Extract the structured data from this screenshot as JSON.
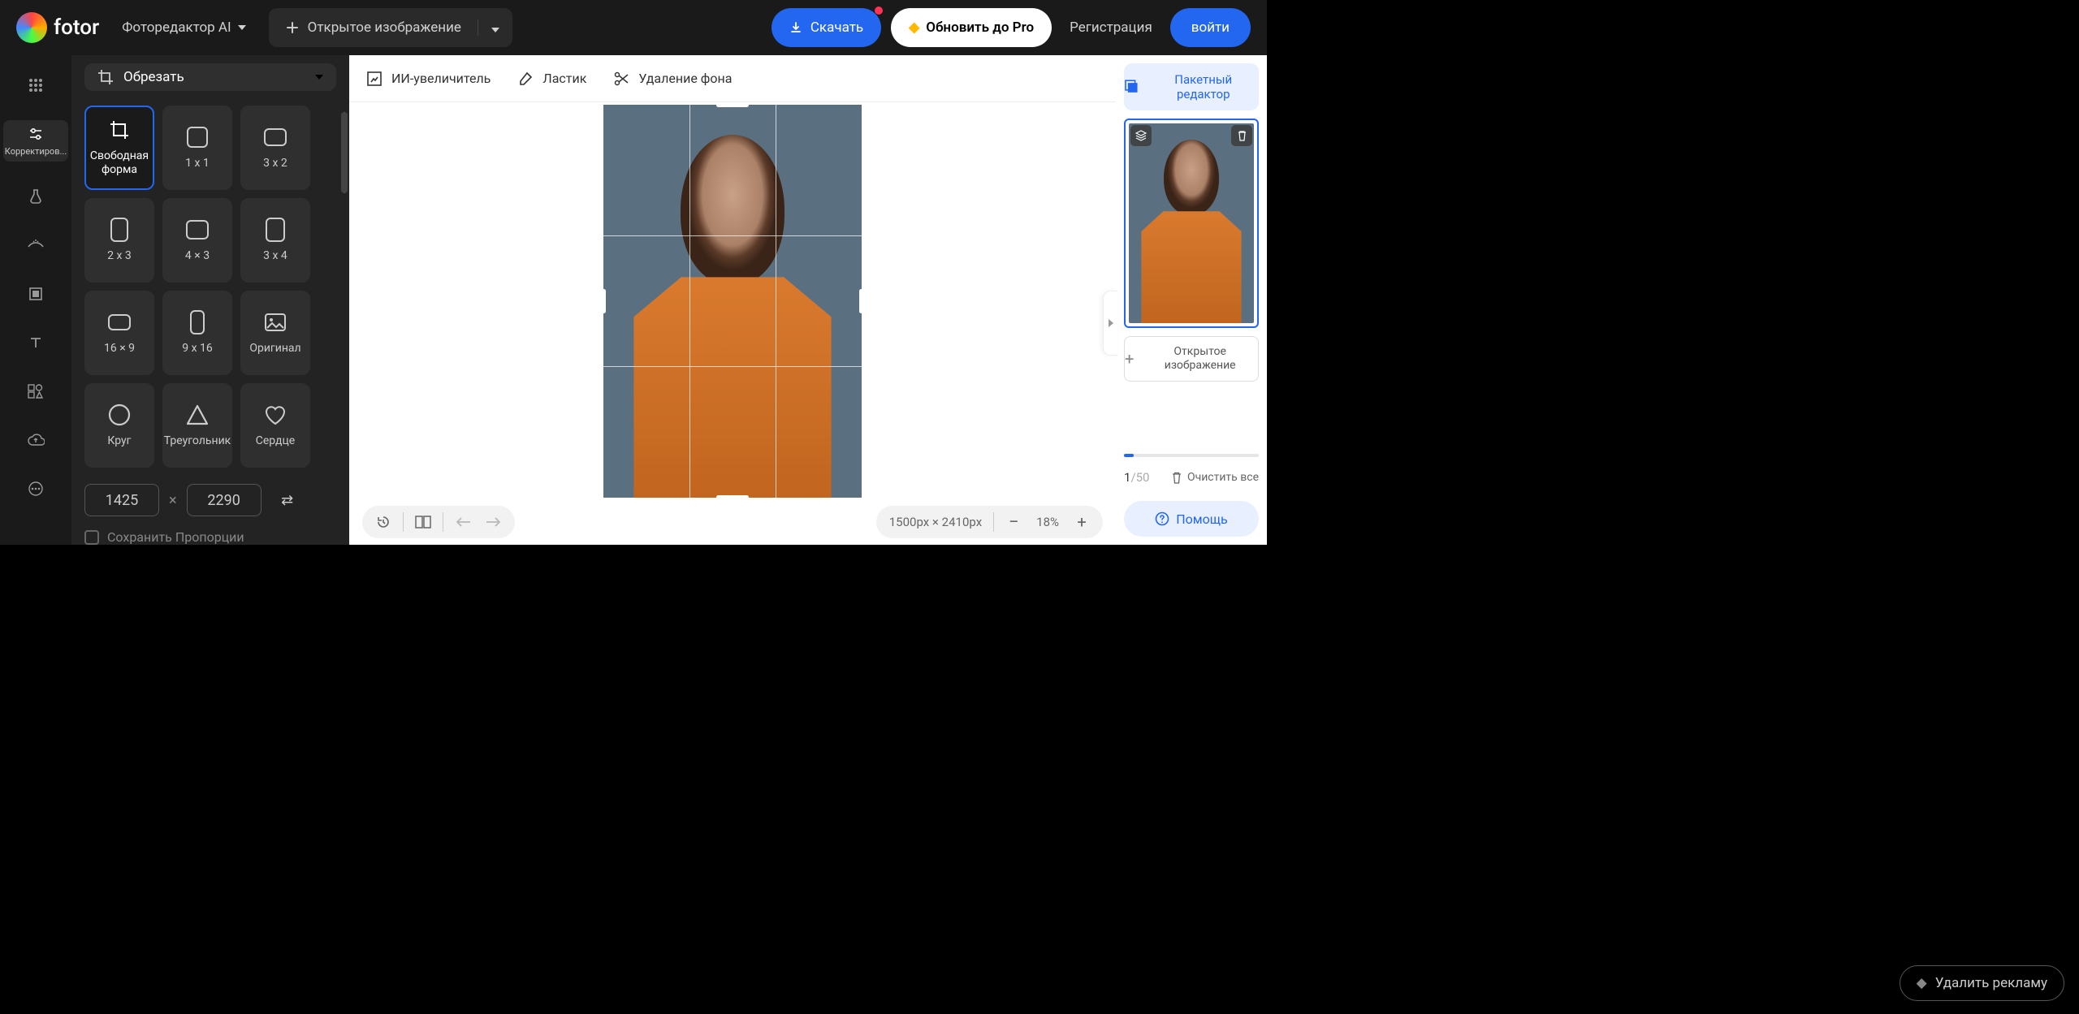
{
  "header": {
    "logo_text": "fotor",
    "mode": "Фоторедактор AI",
    "open_image": "Открытое изображение",
    "download": "Скачать",
    "upgrade": "Обновить до Pro",
    "register": "Регистрация",
    "login": "войти"
  },
  "toolbar": {
    "adjust": "Корректиров..."
  },
  "crop_panel": {
    "title": "Обрезать",
    "options": [
      "Свободная форма",
      "1 x 1",
      "3 x 2",
      "2 x 3",
      "4 × 3",
      "3 x 4",
      "16 × 9",
      "9 x 16",
      "Оригинал",
      "Круг",
      "Треугольник",
      "Сердце"
    ],
    "width": "1425",
    "height": "2290",
    "keep_proportions": "Сохранить Пропорции"
  },
  "canvas_toolbar": {
    "upscaler": "ИИ-увеличитель",
    "eraser": "Ластик",
    "bg_remove": "Удаление фона"
  },
  "canvas_bottom": {
    "dims": "1500px × 2410px",
    "zoom": "18%"
  },
  "right": {
    "batch": "Пакетный редактор",
    "open_image": "Открытое изображение",
    "count_current": "1",
    "count_total": "/50",
    "clear": "Очистить все",
    "help": "Помощь"
  },
  "footer": {
    "remove_ads": "Удалить рекламу"
  }
}
